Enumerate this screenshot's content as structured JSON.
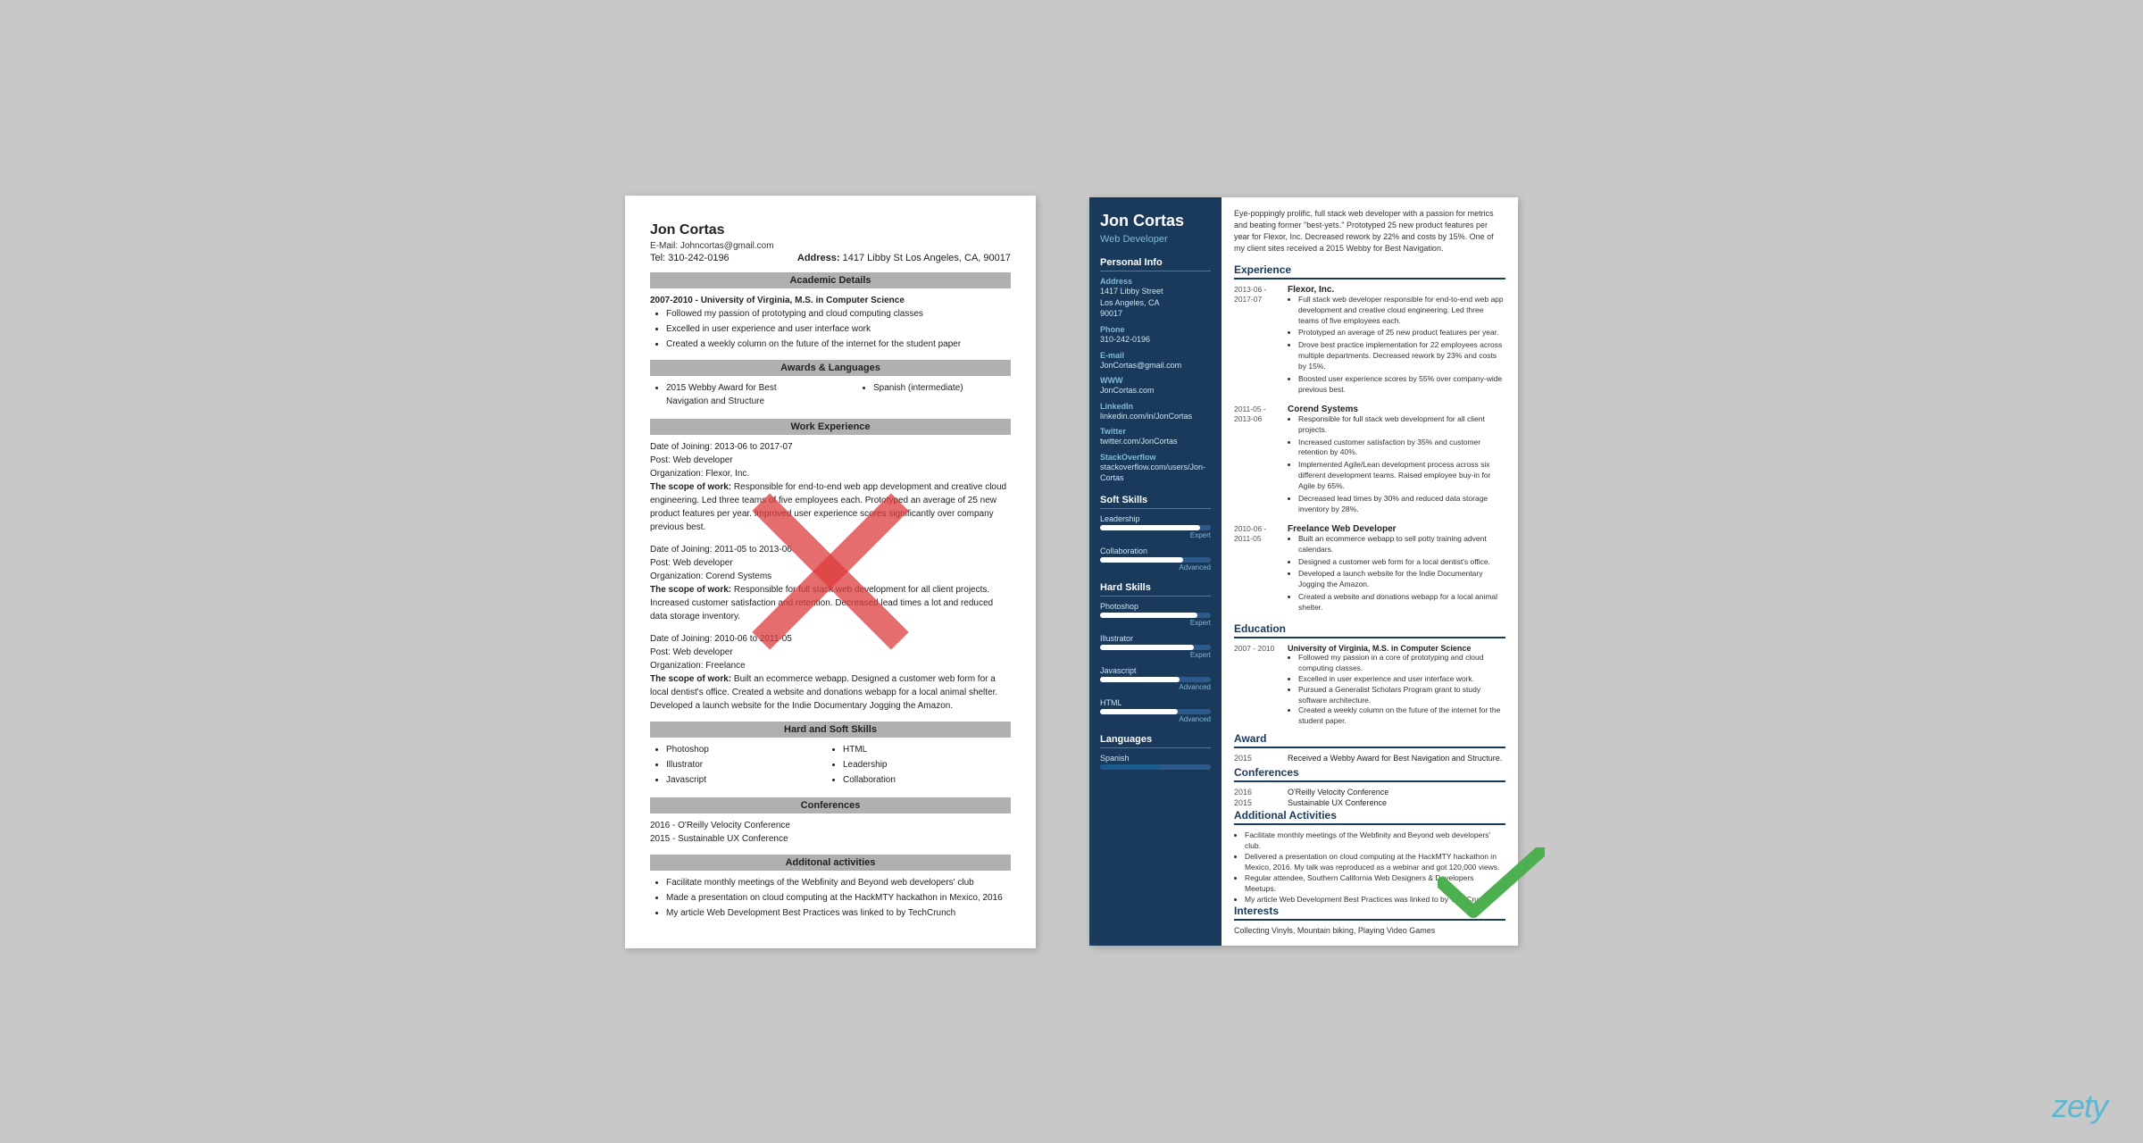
{
  "left_resume": {
    "name": "Jon Cortas",
    "email": "E-Mail: Johncortas@gmail.com",
    "tel": "Tel: 310-242-0196",
    "address_label": "Address:",
    "address": "1417 Libby St Los Angeles, CA, 90017",
    "sections": {
      "academic": {
        "title": "Academic Details",
        "period": "2007-2010 - University of Virginia, M.S. in Computer Science",
        "bullets": [
          "Followed my passion of prototyping and cloud computing classes",
          "Excelled in user experience and user interface work",
          "Created a weekly column on the future of the internet for the student paper"
        ]
      },
      "awards": {
        "title": "Awards & Languages",
        "item1": "2015 Webby Award for Best Navigation and Structure",
        "item2": "Spanish (intermediate)"
      },
      "work": {
        "title": "Work Experience",
        "entries": [
          {
            "date": "Date of Joining: 2013-06 to 2017-07",
            "post": "Post: Web developer",
            "org": "Organization: Flexor, Inc.",
            "scope_label": "The scope of work:",
            "scope": "Responsible for end-to-end web app development and creative cloud engineering. Led three teams of five employees each. Prototyped an average of 25 new product features per year. Improved user experience scores significantly over company previous best."
          },
          {
            "date": "Date of Joining: 2011-05 to 2013-06",
            "post": "Post: Web developer",
            "org": "Organization: Corend Systems",
            "scope_label": "The scope of work:",
            "scope": "Responsible for full stack web development for all client projects. Increased customer satisfaction and retention. Decreased lead times a lot and reduced data storage inventory."
          },
          {
            "date": "Date of Joining: 2010-06 to 2011-05",
            "post": "Post: Web developer",
            "org": "Organization: Freelance",
            "scope_label": "The scope of work:",
            "scope": "Built an ecommerce webapp. Designed a customer web form for a local dentist's office. Created a website and donations webapp for a local animal shelter. Developed a launch website for the Indie Documentary Jogging the Amazon."
          }
        ]
      },
      "skills": {
        "title": "Hard and Soft Skills",
        "items": [
          "Photoshop",
          "Illustrator",
          "Javascript",
          "HTML",
          "Leadership",
          "Collaboration"
        ]
      },
      "conferences": {
        "title": "Conferences",
        "items": [
          "2016 - O'Reilly Velocity Conference",
          "2015 - Sustainable UX Conference"
        ]
      },
      "activities": {
        "title": "Additonal activities",
        "bullets": [
          "Facilitate monthly meetings of the Webfinity and Beyond web developers' club",
          "Made a presentation on cloud computing at the HackMTY hackathon in Mexico, 2016",
          "My article Web Development Best Practices was linked to by TechCrunch"
        ]
      }
    }
  },
  "right_resume": {
    "sidebar": {
      "name": "Jon Cortas",
      "title": "Web Developer",
      "personal_info_title": "Personal Info",
      "address_label": "Address",
      "address_line1": "1417 Libby Street",
      "address_line2": "Los Angeles, CA",
      "address_line3": "90017",
      "phone_label": "Phone",
      "phone": "310-242-0196",
      "email_label": "E-mail",
      "email": "JonCortas@gmail.com",
      "www_label": "WWW",
      "www": "JonCortas.com",
      "linkedin_label": "LinkedIn",
      "linkedin": "linkedin.com/in/JonCortas",
      "twitter_label": "Twitter",
      "twitter": "twitter.com/JonCortas",
      "stackoverflow_label": "StackOverflow",
      "stackoverflow": "stackoverflow.com/users/Jon-Cortas",
      "soft_skills_title": "Soft Skills",
      "skills": [
        {
          "name": "Leadership",
          "level": "Expert",
          "pct": 90
        },
        {
          "name": "Collaboration",
          "level": "Advanced",
          "pct": 75
        }
      ],
      "hard_skills_title": "Hard Skills",
      "hard_skills": [
        {
          "name": "Photoshop",
          "level": "Expert",
          "pct": 88
        },
        {
          "name": "Illustrator",
          "level": "Expert",
          "pct": 85
        },
        {
          "name": "Javascript",
          "level": "Advanced",
          "pct": 72
        },
        {
          "name": "HTML",
          "level": "Advanced",
          "pct": 70
        }
      ],
      "languages_title": "Languages",
      "languages": [
        {
          "name": "Spanish",
          "pct": 55
        }
      ]
    },
    "main": {
      "summary": "Eye-poppingly prolific, full stack web developer with a passion for metrics and beating former \"best-yets.\" Prototyped 25 new product features per year for Flexor, Inc. Decreased rework by 22% and costs by 15%. One of my client sites received a 2015 Webby for Best Navigation.",
      "experience_title": "Experience",
      "experience": [
        {
          "dates": "2013-06 - 2017-07",
          "company": "Flexor, Inc.",
          "bullets": [
            "Full stack web developer responsible for end-to-end web app development and creative cloud engineering. Led three teams of five employees each.",
            "Prototyped an average of 25 new product features per year.",
            "Drove best practice implementation for 22 employees across multiple departments. Decreased rework by 23% and costs by 15%.",
            "Boosted user experience scores by 55% over company-wide previous best."
          ]
        },
        {
          "dates": "2011-05 - 2013-06",
          "company": "Corend Systems",
          "bullets": [
            "Responsible for full stack web development for all client projects.",
            "Increased customer satisfaction by 35% and customer retention by 40%.",
            "Implemented Agile/Lean development process across six different development teams. Raised employee buy-in for Agile by 65%.",
            "Decreased lead times by 30% and reduced data storage inventory by 28%."
          ]
        },
        {
          "dates": "2010-06 - 2011-05",
          "company": "Freelance Web Developer",
          "bullets": [
            "Built an ecommerce webapp to sell potty training advent calendars.",
            "Designed a customer web form for a local dentist's office.",
            "Developed a launch website for the Indie Documentary Jogging the Amazon.",
            "Created a website and donations webapp for a local animal shelter."
          ]
        }
      ],
      "education_title": "Education",
      "education": [
        {
          "dates": "2007 - 2010",
          "title": "University of Virginia, M.S. in Computer Science",
          "bullets": [
            "Followed my passion in a core of prototyping and cloud computing classes.",
            "Excelled in user experience and user interface work.",
            "Pursued a Generalist Scholars Program grant to study software architecture.",
            "Created a weekly column on the future of the internet for the student paper."
          ]
        }
      ],
      "award_title": "Award",
      "award_year": "2015",
      "award_text": "Received a Webby Award for Best Navigation and Structure.",
      "conferences_title": "Conferences",
      "conferences": [
        {
          "year": "2016",
          "name": "O'Reilly Velocity Conference"
        },
        {
          "year": "2015",
          "name": "Sustainable UX Conference"
        }
      ],
      "activities_title": "Additional Activities",
      "activity_bullets": [
        "Facilitate monthly meetings of the Webfinity and Beyond web developers' club.",
        "Delivered a presentation on cloud computing at the HackMTY hackathon in Mexico, 2016. My talk was reproduced as a webinar and got 120,000 views.",
        "Regular attendee, Southern California Web Designers & Developers Meetups.",
        "My article Web Development Best Practices was linked to by TechCrunch."
      ],
      "interests_title": "Interests",
      "interests": "Collecting Vinyls, Mountain biking, Playing Video Games"
    }
  },
  "zety_label": "zety"
}
